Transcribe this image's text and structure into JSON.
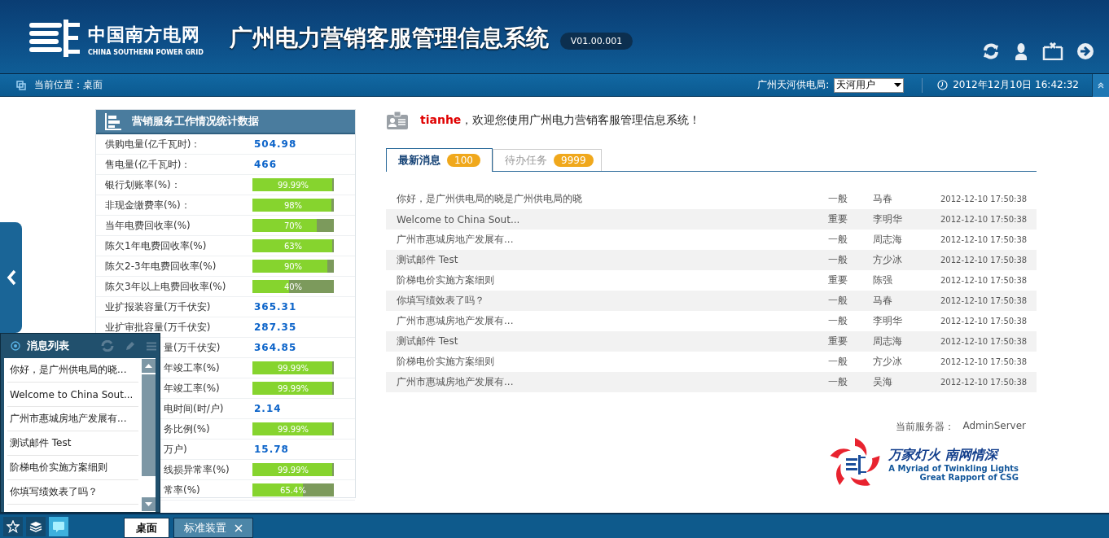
{
  "header": {
    "brand": "中国南方电网",
    "brand_sub": "CHINA SOUTHERN POWER GRID",
    "title": "广州电力营销客服管理信息系统",
    "version": "V01.00.001"
  },
  "nav": {
    "location": "当前位置：桌面",
    "org_label": "广州天河供电局:",
    "org_value": "天河用户",
    "datetime": "2012年12月10日  16:42:32"
  },
  "stats": {
    "title": "营销服务工作情况统计数据",
    "rows": [
      {
        "kind": "value",
        "label": "供购电量(亿千瓦时)：",
        "value": "504.98",
        "clipped": false
      },
      {
        "kind": "value",
        "label": "售电量(亿千瓦时)：",
        "value": "466",
        "clipped": false
      },
      {
        "kind": "bar",
        "label": "银行划账率(%)：",
        "reading": "99.99%",
        "level": 0.98,
        "clipped": false
      },
      {
        "kind": "bar",
        "label": "非现金缴费率(%)：",
        "reading": "98%",
        "level": 0.97,
        "clipped": false
      },
      {
        "kind": "bar",
        "label": "当年电费回收率(%)",
        "reading": "70%",
        "level": 0.79,
        "clipped": false
      },
      {
        "kind": "bar",
        "label": "陈欠1年电费回收率(%)",
        "reading": "63%",
        "level": 0.98,
        "clipped": false
      },
      {
        "kind": "bar",
        "label": "陈欠2-3年电费回收率(%)",
        "reading": "90%",
        "level": 0.92,
        "clipped": false
      },
      {
        "kind": "bar",
        "label": "陈欠3年以上电费回收率(%)",
        "reading": "40%",
        "level": 0.45,
        "clipped": false
      },
      {
        "kind": "value",
        "label": "业扩报装容量(万千伏安)",
        "value": "365.31",
        "clipped": false
      },
      {
        "kind": "value",
        "label": "业扩审批容量(万千伏安)",
        "value": "287.35",
        "clipped": false
      },
      {
        "kind": "value",
        "label": "量(万千伏安)",
        "value": "364.85",
        "clipped": true
      },
      {
        "kind": "bar",
        "label": "年竣工率(%)",
        "reading": "99.99%",
        "level": 0.98,
        "clipped": true
      },
      {
        "kind": "bar",
        "label": "年竣工率(%)",
        "reading": "99.99%",
        "level": 0.98,
        "clipped": true
      },
      {
        "kind": "value",
        "label": "电时间(时/户)",
        "value": "2.14",
        "clipped": true
      },
      {
        "kind": "bar",
        "label": "务比例(%)",
        "reading": "99.99%",
        "level": 0.98,
        "clipped": true
      },
      {
        "kind": "value",
        "label": "万户)",
        "value": "15.78",
        "clipped": true
      },
      {
        "kind": "bar",
        "label": "线损异常率(%)",
        "reading": "99.99%",
        "level": 0.98,
        "clipped": true
      },
      {
        "kind": "bar",
        "label": "常率(%)",
        "reading": "65.4%",
        "level": 0.62,
        "clipped": true
      }
    ]
  },
  "welcome": "**tianhe**，欢迎您使用广州电力营销客服管理信息系统！",
  "tabs": [
    {
      "label": "最新消息",
      "count": "100",
      "selected": true
    },
    {
      "label": "待办任务",
      "count": "9999",
      "selected": false
    }
  ],
  "messages": [
    {
      "subject": "你好，是广州供电局的晓是广州供电局的晓",
      "level": "一般",
      "sender": "马春",
      "time": "2012-12-10 17:50:38"
    },
    {
      "subject": "Welcome to China Sout...",
      "level": "重要",
      "sender": "李明华",
      "time": "2012-12-10 17:50:38"
    },
    {
      "subject": "广州市惠城房地产发展有...",
      "level": "一般",
      "sender": "周志海",
      "time": "2012-12-10 17:50:38"
    },
    {
      "subject": "测试邮件 Test",
      "level": "一般",
      "sender": "方少冰",
      "time": "2012-12-10 17:50:38"
    },
    {
      "subject": "阶梯电价实施方案细则",
      "level": "重要",
      "sender": "陈强",
      "time": "2012-12-10 17:50:38"
    },
    {
      "subject": "你填写绩效表了吗？",
      "level": "一般",
      "sender": "马春",
      "time": "2012-12-10 17:50:38"
    },
    {
      "subject": "广州市惠城房地产发展有...",
      "level": "一般",
      "sender": "李明华",
      "time": "2012-12-10 17:50:38"
    },
    {
      "subject": "测试邮件 Test",
      "level": "重要",
      "sender": "周志海",
      "time": "2012-12-10 17:50:38"
    },
    {
      "subject": "阶梯电价实施方案细则",
      "level": "一般",
      "sender": "方少冰",
      "time": "2012-12-10 17:50:38"
    },
    {
      "subject": "广州市惠城房地产发展有...",
      "level": "一般",
      "sender": "吴海",
      "time": "2012-12-10 17:50:38"
    }
  ],
  "server": {
    "label": "当前服务器：",
    "value": "AdminServer"
  },
  "slogan": {
    "cn": "万家灯火 南网情深",
    "en1": "A Myriad of Twinkling Lights",
    "en2": "Great Rapport of CSG"
  },
  "message_list": {
    "title": "消息列表",
    "items": [
      "你好，是广州供电局的晓...",
      "Welcome to China Sout...",
      "广州市惠城房地产发展有...",
      "测试邮件 Test",
      "阶梯电价实施方案细则",
      "你填写绩效表了吗？"
    ]
  },
  "dock": [
    {
      "kind": "star",
      "selected": false
    },
    {
      "kind": "layers",
      "selected": false
    },
    {
      "kind": "chat",
      "selected": true
    }
  ],
  "page_tabs": [
    {
      "label": "桌面",
      "selected": true,
      "closable": false
    },
    {
      "label": "标准装置",
      "selected": false,
      "closable": true
    }
  ]
}
